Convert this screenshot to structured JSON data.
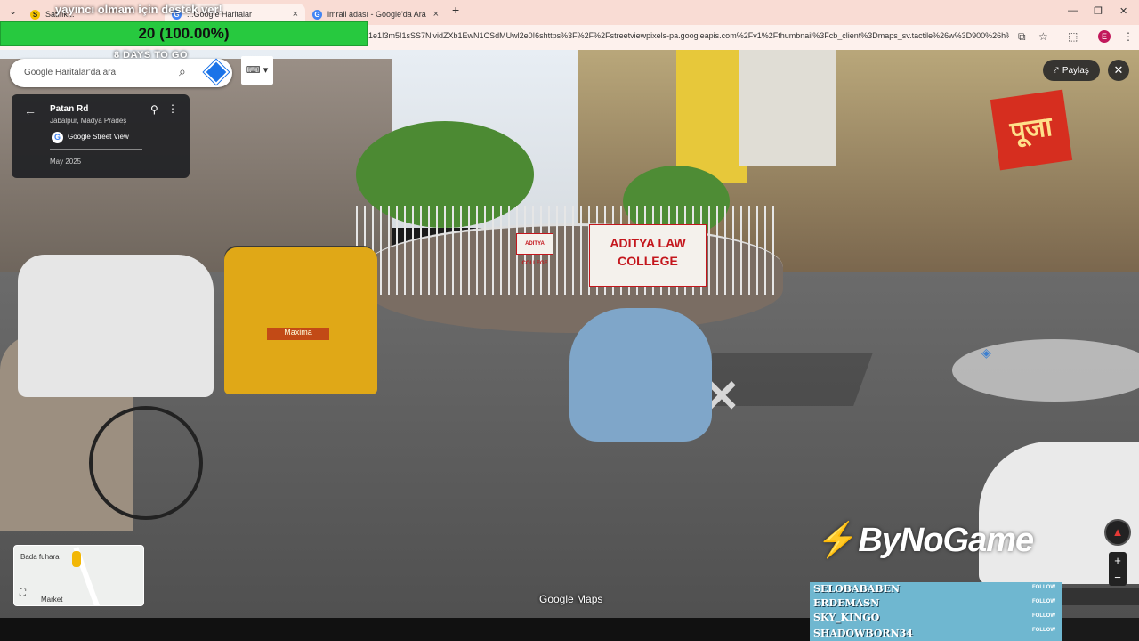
{
  "browser": {
    "tabs": [
      {
        "label": "Satılık...",
        "favicon": "S",
        "favicon_color": "#f2c200"
      },
      {
        "label": "...Google Haritalar",
        "favicon": "G"
      },
      {
        "label": "imrali adası - Google'da Ara",
        "favicon": "G"
      }
    ],
    "url": "1e1!3m5!1sSS7NlvidZXb1EwN1CSdMUwl2e0!6shttps%3F%2F%2Fstreetviewpixels-pa.googleapis.com%2Fv1%2Fthumbnail%3Fcb_client%3Dmaps_sv.tactile%26w%3D900%26h%3...",
    "profile_initial": "E"
  },
  "stream": {
    "top_text": "yayıncı olmam için destek ver!",
    "progress_label": "20 (100.00%)",
    "progress_fraction": 1.0,
    "days_left": "8 DAYS TO GO",
    "brand": "ByNoGame",
    "followers": [
      {
        "name": "SELOBABABEN",
        "tag": "FOLLOW"
      },
      {
        "name": "ERDEMASN",
        "tag": "FOLLOW"
      },
      {
        "name": "SKY_KINGO",
        "tag": "FOLLOW"
      },
      {
        "name": "SHADOWBORN34",
        "tag": "FOLLOW"
      }
    ]
  },
  "maps": {
    "search_placeholder": "Google Haritalar'da ara",
    "place_title": "Patan Rd",
    "place_sub": "Jabalpur, Madya Pradeş",
    "provider": "Google Street View",
    "capture_date": "May 2025",
    "share_label": "Paylaş",
    "minimap_labels": [
      "Bada fuhara",
      "Market"
    ],
    "watermark": "Google Maps"
  },
  "scene": {
    "sign_college": "ADITYA LAW COLLEGE",
    "sign_college2": "ADITYA COLLEGE",
    "sign_puja": "पूजा",
    "rickshaw_plate": "Maxima"
  }
}
